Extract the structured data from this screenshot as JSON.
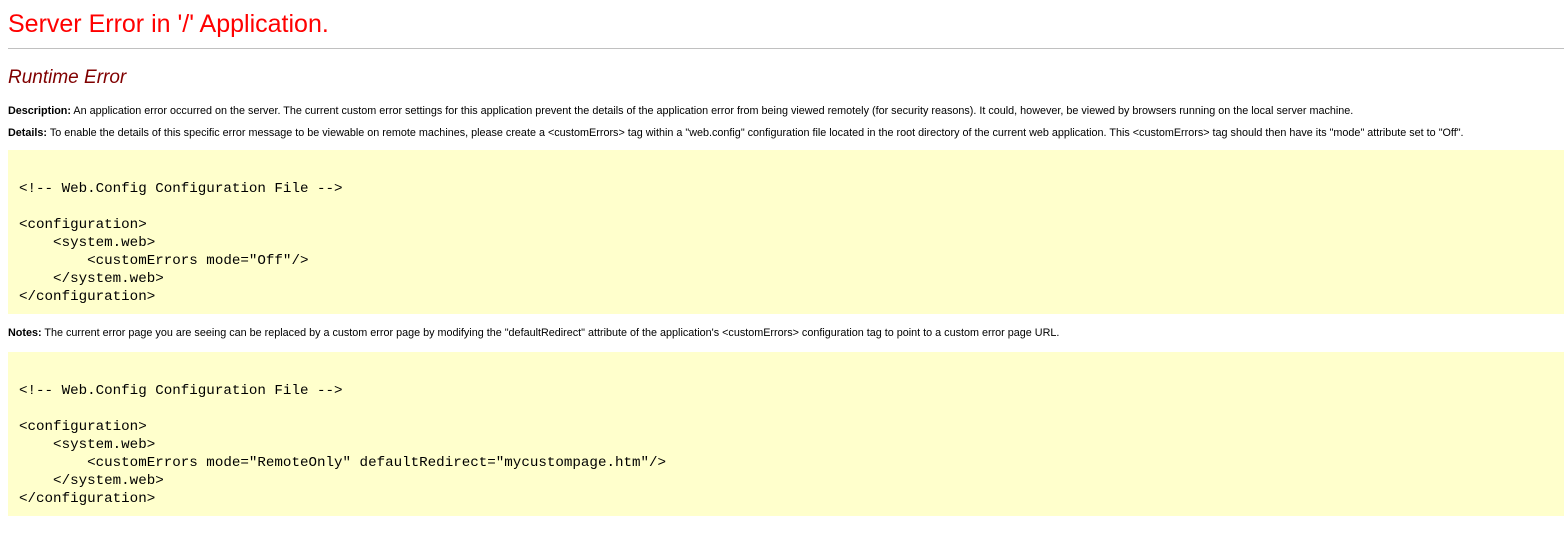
{
  "page": {
    "title": "Server Error in '/' Application.",
    "subtitle": "Runtime Error"
  },
  "description": {
    "label": "Description:",
    "text": " An application error occurred on the server. The current custom error settings for this application prevent the details of the application error from being viewed remotely (for security reasons). It could, however, be viewed by browsers running on the local server machine."
  },
  "details": {
    "label": "Details:",
    "text": " To enable the details of this specific error message to be viewable on remote machines, please create a <customErrors> tag within a \"web.config\" configuration file located in the root directory of the current web application. This <customErrors> tag should then have its \"mode\" attribute set to \"Off\"."
  },
  "code_block_1": {
    "lines": [
      "",
      "<!-- Web.Config Configuration File -->",
      "",
      "<configuration>",
      "    <system.web>",
      "        <customErrors mode=\"Off\"/>",
      "    </system.web>",
      "</configuration>"
    ]
  },
  "notes": {
    "label": "Notes:",
    "text": " The current error page you are seeing can be replaced by a custom error page by modifying the \"defaultRedirect\" attribute of the application's <customErrors> configuration tag to point to a custom error page URL."
  },
  "code_block_2": {
    "lines": [
      "",
      "<!-- Web.Config Configuration File -->",
      "",
      "<configuration>",
      "    <system.web>",
      "        <customErrors mode=\"RemoteOnly\" defaultRedirect=\"mycustompage.htm\"/>",
      "    </system.web>",
      "</configuration>"
    ]
  },
  "colors": {
    "title": "#ff0000",
    "subtitle": "#800000",
    "code_background": "#ffffcc",
    "divider": "#c0c0c0"
  }
}
